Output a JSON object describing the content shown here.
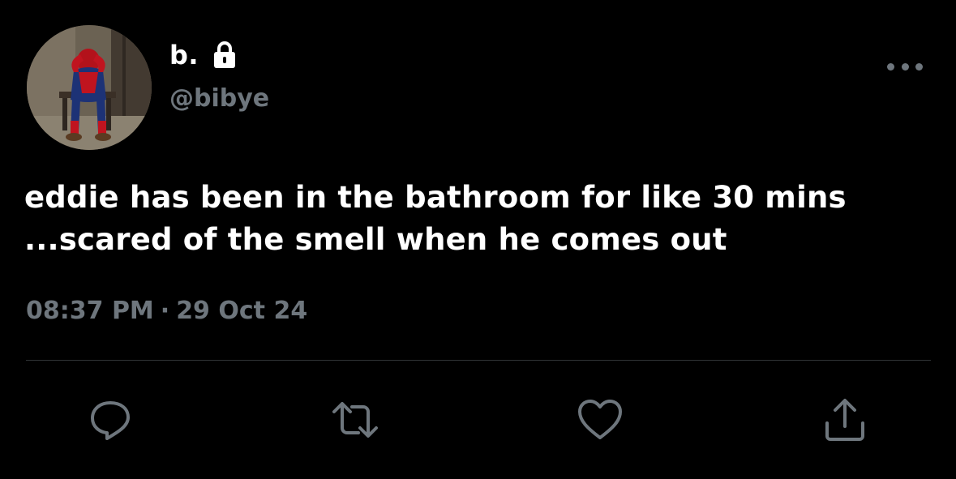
{
  "user": {
    "display_name": "b.",
    "handle": "@bibye",
    "protected_icon": "lock-icon",
    "avatar": "profile-avatar"
  },
  "tweet": {
    "text_lines": [
      "eddie has been in the bathroom for like 30 mins",
      "...scared of the smell when he comes out"
    ],
    "time": "08:37 PM",
    "separator": "·",
    "date": "29 Oct 24"
  },
  "actions": [
    {
      "name": "reply",
      "icon": "reply-icon"
    },
    {
      "name": "retweet",
      "icon": "retweet-icon"
    },
    {
      "name": "like",
      "icon": "heart-icon"
    },
    {
      "name": "share",
      "icon": "share-icon"
    }
  ],
  "menu_icon": "more-options-icon",
  "colors": {
    "background": "#000000",
    "primary_text": "#ffffff",
    "secondary_text": "#6e767d",
    "divider": "#2f3336"
  }
}
